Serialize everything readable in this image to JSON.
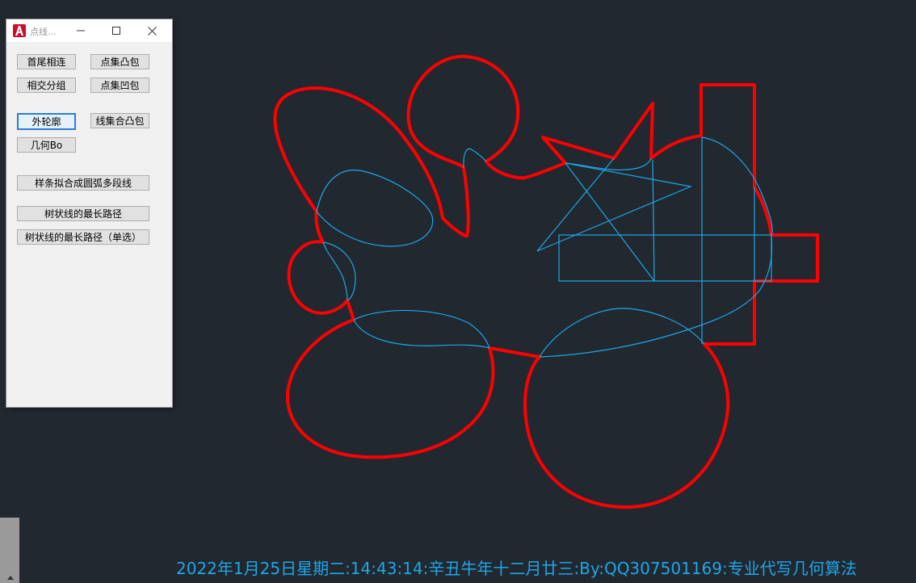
{
  "dialog": {
    "title": "点线...",
    "buttons": {
      "connect_ends": "首尾相连",
      "point_convex_hull": "点集凸包",
      "intersect_group": "相交分组",
      "point_concave_hull": "点集凹包",
      "outer_contour": "外轮廓",
      "line_convex_hull": "线集合凸包",
      "geometry_bo": "几何Bo",
      "spline_fit": "样条拟合成圆弧多段线",
      "tree_longest": "树状线的最长路径",
      "tree_longest_single": "树状线的最长路径（单选）"
    }
  },
  "status_line": "2022年1月25日星期二:14:43:14:辛丑牛年十二月廿三:By:QQ307501169:专业代写几何算法",
  "colors": {
    "background": "#212830",
    "outline": "#ff0000",
    "entities": "#1ea7e8",
    "status_text": "#1ea7e8"
  },
  "icons": {
    "app": "autocad-logo-icon",
    "minimize": "minimize-icon",
    "maximize": "maximize-icon",
    "close": "close-icon"
  }
}
